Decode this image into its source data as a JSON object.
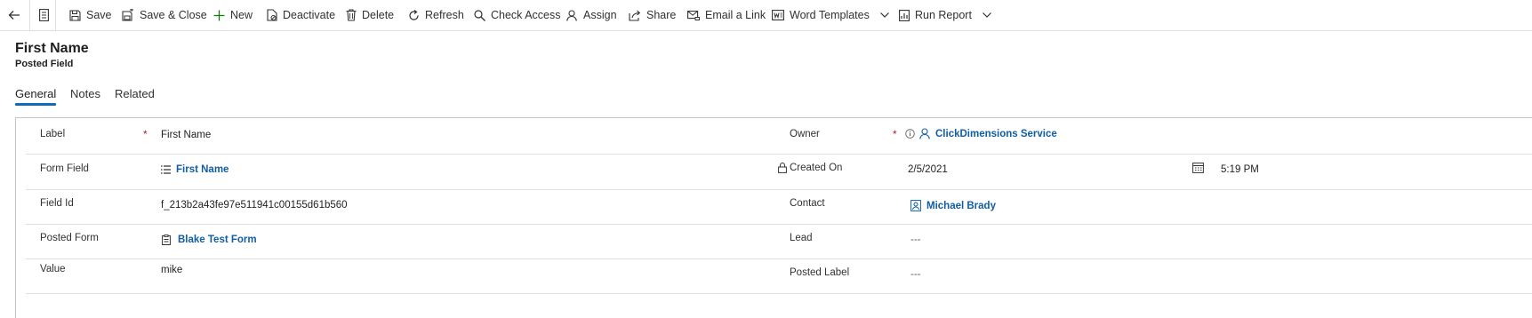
{
  "toolbar": {
    "back_label": "",
    "save": "Save",
    "save_close": "Save & Close",
    "new": "New",
    "deactivate": "Deactivate",
    "delete": "Delete",
    "refresh": "Refresh",
    "check_access": "Check Access",
    "assign": "Assign",
    "share": "Share",
    "email_link": "Email a Link",
    "word_templates": "Word Templates",
    "run_report": "Run Report"
  },
  "header": {
    "title": "First Name",
    "subtitle": "Posted Field"
  },
  "tabs": [
    {
      "label": "General",
      "active": true
    },
    {
      "label": "Notes",
      "active": false
    },
    {
      "label": "Related",
      "active": false
    }
  ],
  "left_fields": [
    {
      "label": "Label",
      "value": "First Name",
      "required": "*"
    },
    {
      "label": "Form Field",
      "value": "First Name"
    },
    {
      "label": "Field Id",
      "value": "f_213b2a43fe97e511941c00155d61b560"
    },
    {
      "label": "Posted Form",
      "value": "Blake Test Form"
    },
    {
      "label": "Value",
      "value": "mike"
    }
  ],
  "right_fields": [
    {
      "label": "Owner",
      "value": "ClickDimensions Service",
      "required": "*"
    },
    {
      "label": "Created On",
      "date": "2/5/2021",
      "time": "5:19 PM"
    },
    {
      "label": "Contact",
      "value": "Michael Brady"
    },
    {
      "label": "Lead",
      "value": "---"
    },
    {
      "label": "Posted Label",
      "value": "---"
    }
  ],
  "colors": {
    "accent": "#0f6cbd",
    "link": "#115ea3",
    "required": "#a4262c",
    "new_icon": "#107c10"
  }
}
